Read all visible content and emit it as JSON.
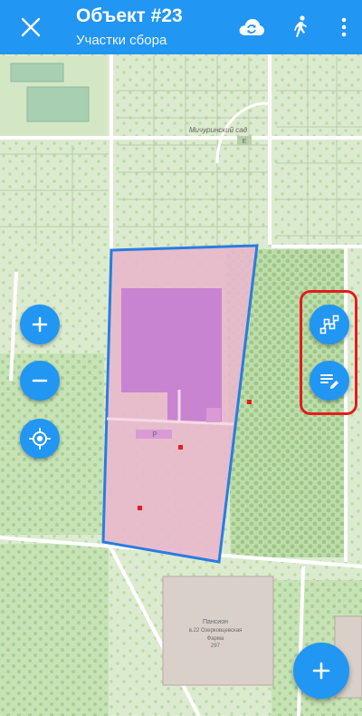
{
  "header": {
    "title": "Объект #23",
    "subtitle": "Участки сбора"
  },
  "icons": {
    "close": "close-icon",
    "sync": "cloud-sync-icon",
    "walk": "walking-person-icon",
    "more": "more-vertical-icon",
    "zoom_in": "plus-icon",
    "zoom_out": "minus-icon",
    "locate": "my-location-icon",
    "edit_geometry": "polygon-edit-icon",
    "edit_attributes": "edit-notes-icon",
    "add": "plus-icon"
  },
  "map": {
    "labels": {
      "garden": "Мичуринский сад",
      "garden_mark": "Е",
      "building_name": "Пансион",
      "building_address": "в.22 Озерковцевская",
      "building_extra": "Фарма",
      "building_number": "297",
      "parking": "P"
    }
  },
  "colors": {
    "accent": "#2196f3",
    "highlight": "#e31d1d",
    "polygon_border": "#2a7de1",
    "forest": "#c3dfb3"
  }
}
